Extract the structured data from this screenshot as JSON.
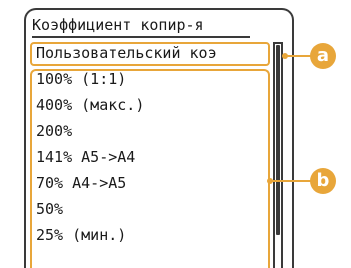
{
  "screen": {
    "title": "Коэффициент копир-я",
    "selected_item": "Пользовательский коэ",
    "options": [
      "100% (1:1)",
      "400% (макс.)",
      "200%",
      "141% A5->A4",
      "70% A4->A5",
      "50%",
      "25% (мин.)"
    ]
  },
  "callouts": {
    "a": "a",
    "b": "b"
  },
  "colors": {
    "callout": "#e8a63a",
    "frame": "#3a3a3a",
    "text": "#1a1a1a"
  },
  "icons": {
    "callout_a": "callout-badge-a",
    "callout_b": "callout-badge-b"
  }
}
